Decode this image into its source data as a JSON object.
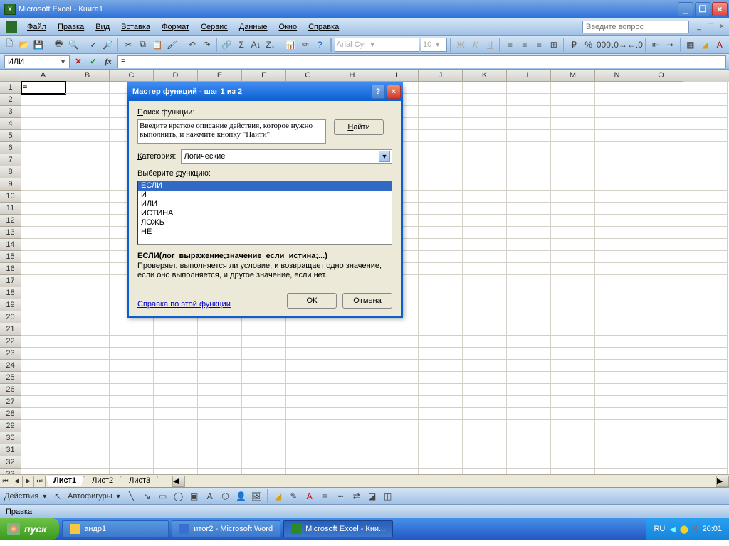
{
  "titlebar": {
    "title": "Microsoft Excel - Книга1"
  },
  "menubar": {
    "items": [
      "Файл",
      "Правка",
      "Вид",
      "Вставка",
      "Формат",
      "Сервис",
      "Данные",
      "Окно",
      "Справка"
    ],
    "question_placeholder": "Введите вопрос"
  },
  "toolbar": {
    "font_name": "Arial Cyr",
    "font_size": "10"
  },
  "formula_bar": {
    "name_box": "ИЛИ",
    "content": "="
  },
  "grid": {
    "columns": [
      "A",
      "B",
      "C",
      "D",
      "E",
      "F",
      "G",
      "H",
      "I",
      "J",
      "K",
      "L",
      "M",
      "N",
      "O"
    ],
    "rows_visible": 33,
    "active_cell": "A1",
    "a1_value": "="
  },
  "sheettabs": {
    "active": "Лист1",
    "tabs": [
      "Лист1",
      "Лист2",
      "Лист3"
    ]
  },
  "drawbar": {
    "actions_label": "Действия",
    "autoshapes_label": "Автофигуры"
  },
  "statusbar": {
    "text": "Правка"
  },
  "taskbar": {
    "start": "пуск",
    "items": [
      {
        "label": "андр1",
        "icon_color": "#f4c842"
      },
      {
        "label": "итог2 - Microsoft Word",
        "icon_color": "#3a6fd0"
      },
      {
        "label": "Microsoft Excel - Кни...",
        "icon_color": "#2a8a2a",
        "active": true
      }
    ],
    "lang": "RU",
    "clock": "20:01"
  },
  "dialog": {
    "title": "Мастер функций - шаг 1 из 2",
    "search_label": "Поиск функции:",
    "search_text": "Введите краткое описание действия, которое нужно выполнить, и нажмите кнопку \"Найти\"",
    "find_btn": "Найти",
    "category_label": "Категория:",
    "category_value": "Логические",
    "choose_label": "Выберите функцию:",
    "functions": [
      "ЕСЛИ",
      "И",
      "ИЛИ",
      "ИСТИНА",
      "ЛОЖЬ",
      "НЕ"
    ],
    "selected_function": "ЕСЛИ",
    "signature": "ЕСЛИ(лог_выражение;значение_если_истина;...)",
    "description": "Проверяет, выполняется ли условие, и возвращает одно значение, если оно выполняется, и другое значение, если нет.",
    "help_link": "Справка по этой функции",
    "ok": "ОК",
    "cancel": "Отмена"
  }
}
